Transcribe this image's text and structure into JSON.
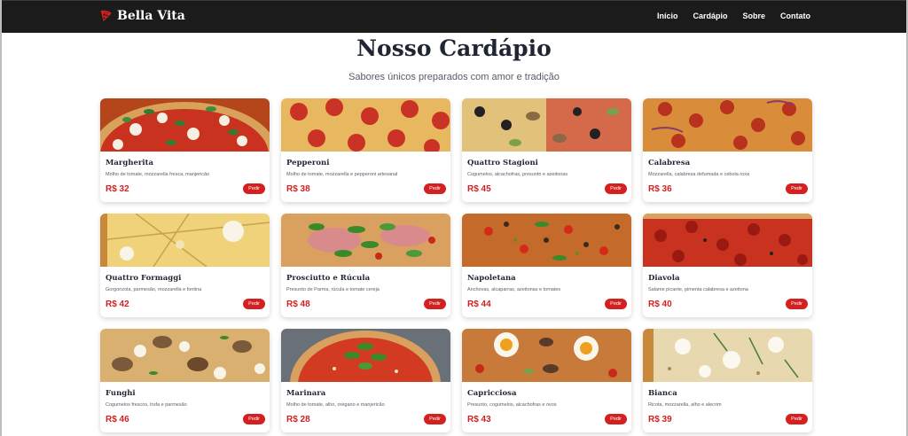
{
  "nav": {
    "brand": "Bella Vita",
    "links": [
      "Início",
      "Cardápio",
      "Sobre",
      "Contato"
    ]
  },
  "header": {
    "title": "Nosso Cardápio",
    "subtitle": "Sabores únicos preparados com amor e tradição"
  },
  "menu": {
    "order_label": "Pedir",
    "items": [
      {
        "name": "Margherita",
        "desc": "Molho de tomate, mozzarella fresca, manjericão",
        "price": "R$ 32"
      },
      {
        "name": "Pepperoni",
        "desc": "Molho de tomate, mozzarella e pepperoni artesanal",
        "price": "R$ 38"
      },
      {
        "name": "Quattro Stagioni",
        "desc": "Cogumelos, alcachofras, presunto e azeitonas",
        "price": "R$ 45"
      },
      {
        "name": "Calabresa",
        "desc": "Mozzarella, calabresa defumada e cebola roxa",
        "price": "R$ 36"
      },
      {
        "name": "Quattro Formaggi",
        "desc": "Gorgonzola, parmesão, mozzarella e fontina",
        "price": "R$ 42"
      },
      {
        "name": "Prosciutto e Rúcula",
        "desc": "Presunto de Parma, rúcula e tomate cereja",
        "price": "R$ 48"
      },
      {
        "name": "Napoletana",
        "desc": "Anchovas, alcaparras, azeitonas e tomates",
        "price": "R$ 44"
      },
      {
        "name": "Diavola",
        "desc": "Salame picante, pimenta calabresa e azeitona",
        "price": "R$ 40"
      },
      {
        "name": "Funghi",
        "desc": "Cogumelos frescos, trufa e parmesão",
        "price": "R$ 46"
      },
      {
        "name": "Marinara",
        "desc": "Molho de tomate, alho, orégano e manjericão",
        "price": "R$ 28"
      },
      {
        "name": "Capricciosa",
        "desc": "Presunto, cogumelos, alcachofras e ovos",
        "price": "R$ 43"
      },
      {
        "name": "Bianca",
        "desc": "Ricota, mozzarella, alho e alecrim",
        "price": "R$ 39"
      }
    ]
  },
  "colors": {
    "navbar_bg": "#1b1b1b",
    "accent": "#d32020",
    "heading": "#1f2533"
  }
}
